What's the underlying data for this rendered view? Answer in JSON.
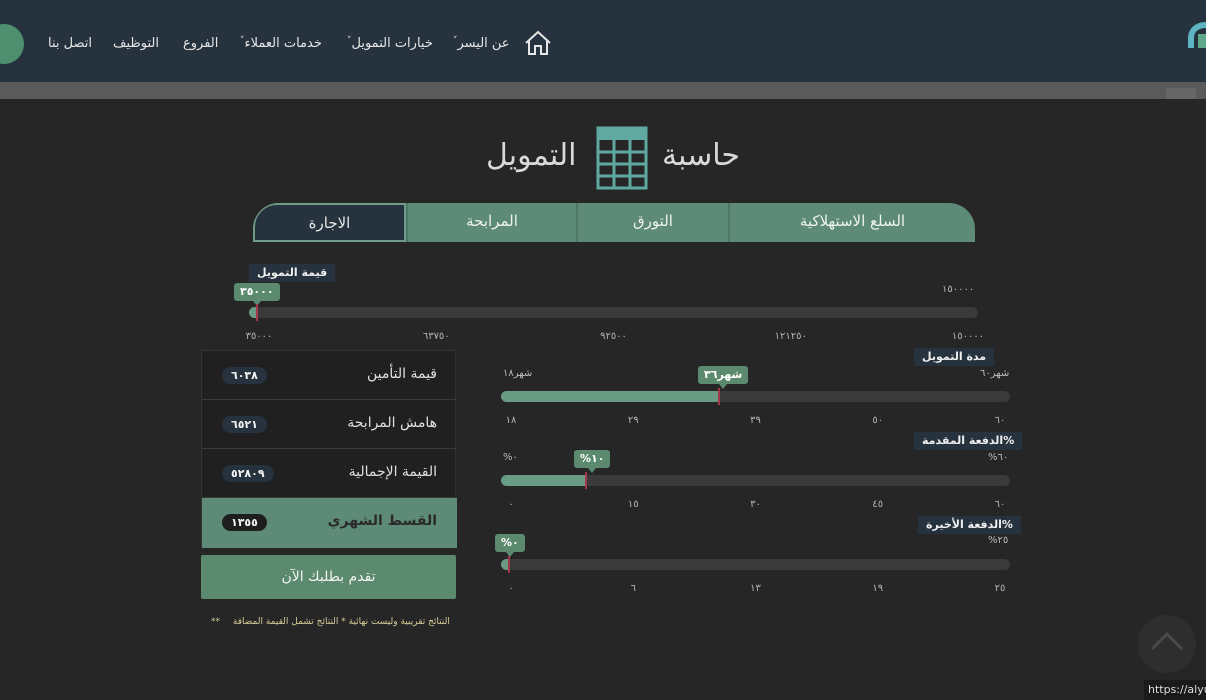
{
  "nav": {
    "contact": "اتصل بنا",
    "jobs": "التوظيف",
    "branches": "الفروع",
    "customer_services": "خدمات العملاء",
    "financing_options": "خيارات التمويل",
    "about": "عن اليسر",
    "caret": "˅"
  },
  "title": {
    "word1": "حاسبة",
    "word2": "التمويل"
  },
  "tabs": [
    "السلع الاستهلاكية",
    "التورق",
    "المرابحة",
    "الاجارة"
  ],
  "amount": {
    "label": "قيمة التمويل",
    "value": "٣٥٠٠٠",
    "max": "١٥٠٠٠٠",
    "fraction": 0.0,
    "ticks": [
      "٣٥٠٠٠",
      "٦٣٧٥٠",
      "٩٢٥٠٠",
      "١٢١٢٥٠",
      "١٥٠٠٠٠"
    ]
  },
  "duration": {
    "label": "مدة التمويل",
    "value": "شهر٣٦",
    "min": "شهر١٨",
    "max": "شهر٦٠",
    "fraction": 0.4286,
    "ticks": [
      "١٨",
      "٢٩",
      "٣٩",
      "٥٠",
      "٦٠"
    ]
  },
  "down_payment": {
    "label": "الدفعة المقدمة%",
    "value": "%١٠",
    "min": "%٠",
    "max": "%٦٠",
    "fraction": 0.1667,
    "ticks": [
      "٠",
      "١٥",
      "٣٠",
      "٤٥",
      "٦٠"
    ]
  },
  "last_payment": {
    "label": "الدفعة الأخيرة%",
    "value": "%٠",
    "max": "%٢٥",
    "fraction": 0.0,
    "ticks": [
      "٠",
      "٦",
      "١٣",
      "١٩",
      "٢٥"
    ]
  },
  "results": {
    "insurance": {
      "label": "قيمة التأمين",
      "value": "٦٠٣٨"
    },
    "margin": {
      "label": "هامش المرابحة",
      "value": "٦٥٢١"
    },
    "total": {
      "label": "القيمة الإجمالية",
      "value": "٥٢٨٠٩"
    },
    "monthly": {
      "label": "القسط الشهري",
      "value": "١٣٥٥"
    }
  },
  "apply_button": "تقدم بطلبك الآن",
  "notes": {
    "vat": "* النتائج تشمل القيمة المضافة",
    "approx": "** النتائج تقريبية وليست نهائية"
  },
  "statusbar_url": "https://alyu",
  "colors": {
    "header": "#26333e",
    "accent": "#5e8a78",
    "handle": "#a5384a"
  }
}
